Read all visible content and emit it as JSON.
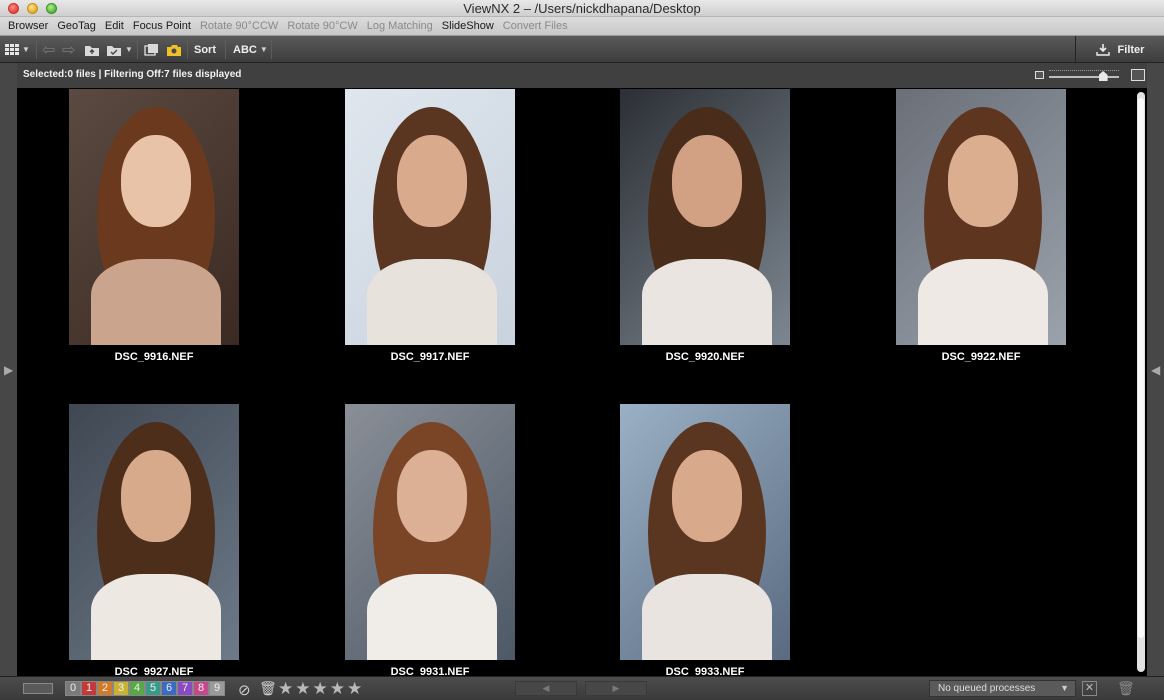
{
  "window": {
    "title": "ViewNX 2 – /Users/nickdhapana/Desktop"
  },
  "menu": [
    {
      "label": "Browser",
      "enabled": true
    },
    {
      "label": "GeoTag",
      "enabled": true
    },
    {
      "label": "Edit",
      "enabled": true
    },
    {
      "label": "Focus Point",
      "enabled": true
    },
    {
      "label": "Rotate 90°CCW",
      "enabled": false
    },
    {
      "label": "Rotate 90°CW",
      "enabled": false
    },
    {
      "label": "Log Matching",
      "enabled": false
    },
    {
      "label": "SlideShow",
      "enabled": true
    },
    {
      "label": "Convert Files",
      "enabled": false
    }
  ],
  "toolbar": {
    "sort_label": "Sort",
    "abc_label": "ABC",
    "filter_label": "Filter",
    "icons": [
      "grid-view-icon",
      "back-arrow-icon",
      "forward-arrow-icon",
      "folder-up-icon",
      "folder-mark-icon",
      "duplicate-icon",
      "camera-folder-icon",
      "download-icon"
    ]
  },
  "status": {
    "text": "Selected:0 files | Filtering Off:7 files displayed",
    "thumbnail_zoom_fraction": 0.78
  },
  "files": [
    {
      "name": "DSC_9916.NEF"
    },
    {
      "name": "DSC_9917.NEF"
    },
    {
      "name": "DSC_9920.NEF"
    },
    {
      "name": "DSC_9922.NEF"
    },
    {
      "name": "DSC_9927.NEF"
    },
    {
      "name": "DSC_9931.NEF"
    },
    {
      "name": "DSC_9933.NEF"
    }
  ],
  "bottom": {
    "labels": [
      "0",
      "1",
      "2",
      "3",
      "4",
      "5",
      "6",
      "7",
      "8",
      "9"
    ],
    "label_colors": [
      "#7a7a7a",
      "#c23a3a",
      "#d07a2a",
      "#c9b233",
      "#58a846",
      "#3a9a8a",
      "#3a6ac2",
      "#8a4ac2",
      "#c24a8a",
      "#9a9a9a"
    ],
    "rating_stars": 5,
    "queue_text": "No queued processes"
  },
  "colors": {
    "content_bg": "#000000",
    "chrome_dark": "#3d3d3d",
    "text_light": "#f0f0f0"
  }
}
